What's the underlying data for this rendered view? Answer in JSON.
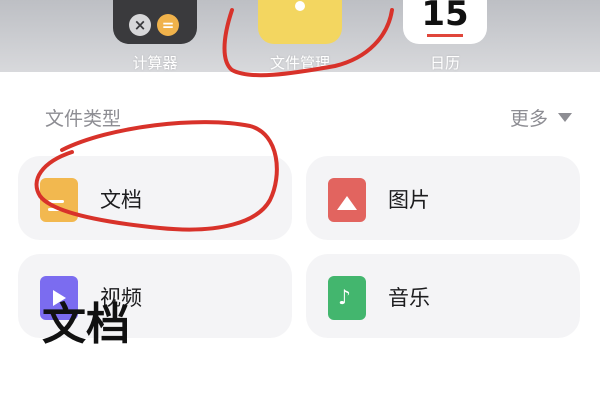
{
  "dock": {
    "apps": [
      {
        "label": "计算器",
        "icon": "calculator-icon",
        "keys": [
          "×",
          "="
        ]
      },
      {
        "label": "文件管理",
        "icon": "folder-icon"
      },
      {
        "label": "日历",
        "icon": "calendar-icon",
        "day": "15"
      }
    ]
  },
  "section": {
    "title": "文件类型",
    "more_label": "更多"
  },
  "categories": [
    {
      "label": "文档",
      "icon": "document-icon"
    },
    {
      "label": "图片",
      "icon": "image-icon"
    },
    {
      "label": "视频",
      "icon": "video-icon"
    },
    {
      "label": "音乐",
      "icon": "music-icon"
    }
  ],
  "page_heading": "文档",
  "colors": {
    "document": "#f2b84f",
    "image": "#e2645f",
    "video": "#7b6cf0",
    "music": "#43b66e",
    "annotation": "#d8322a"
  }
}
